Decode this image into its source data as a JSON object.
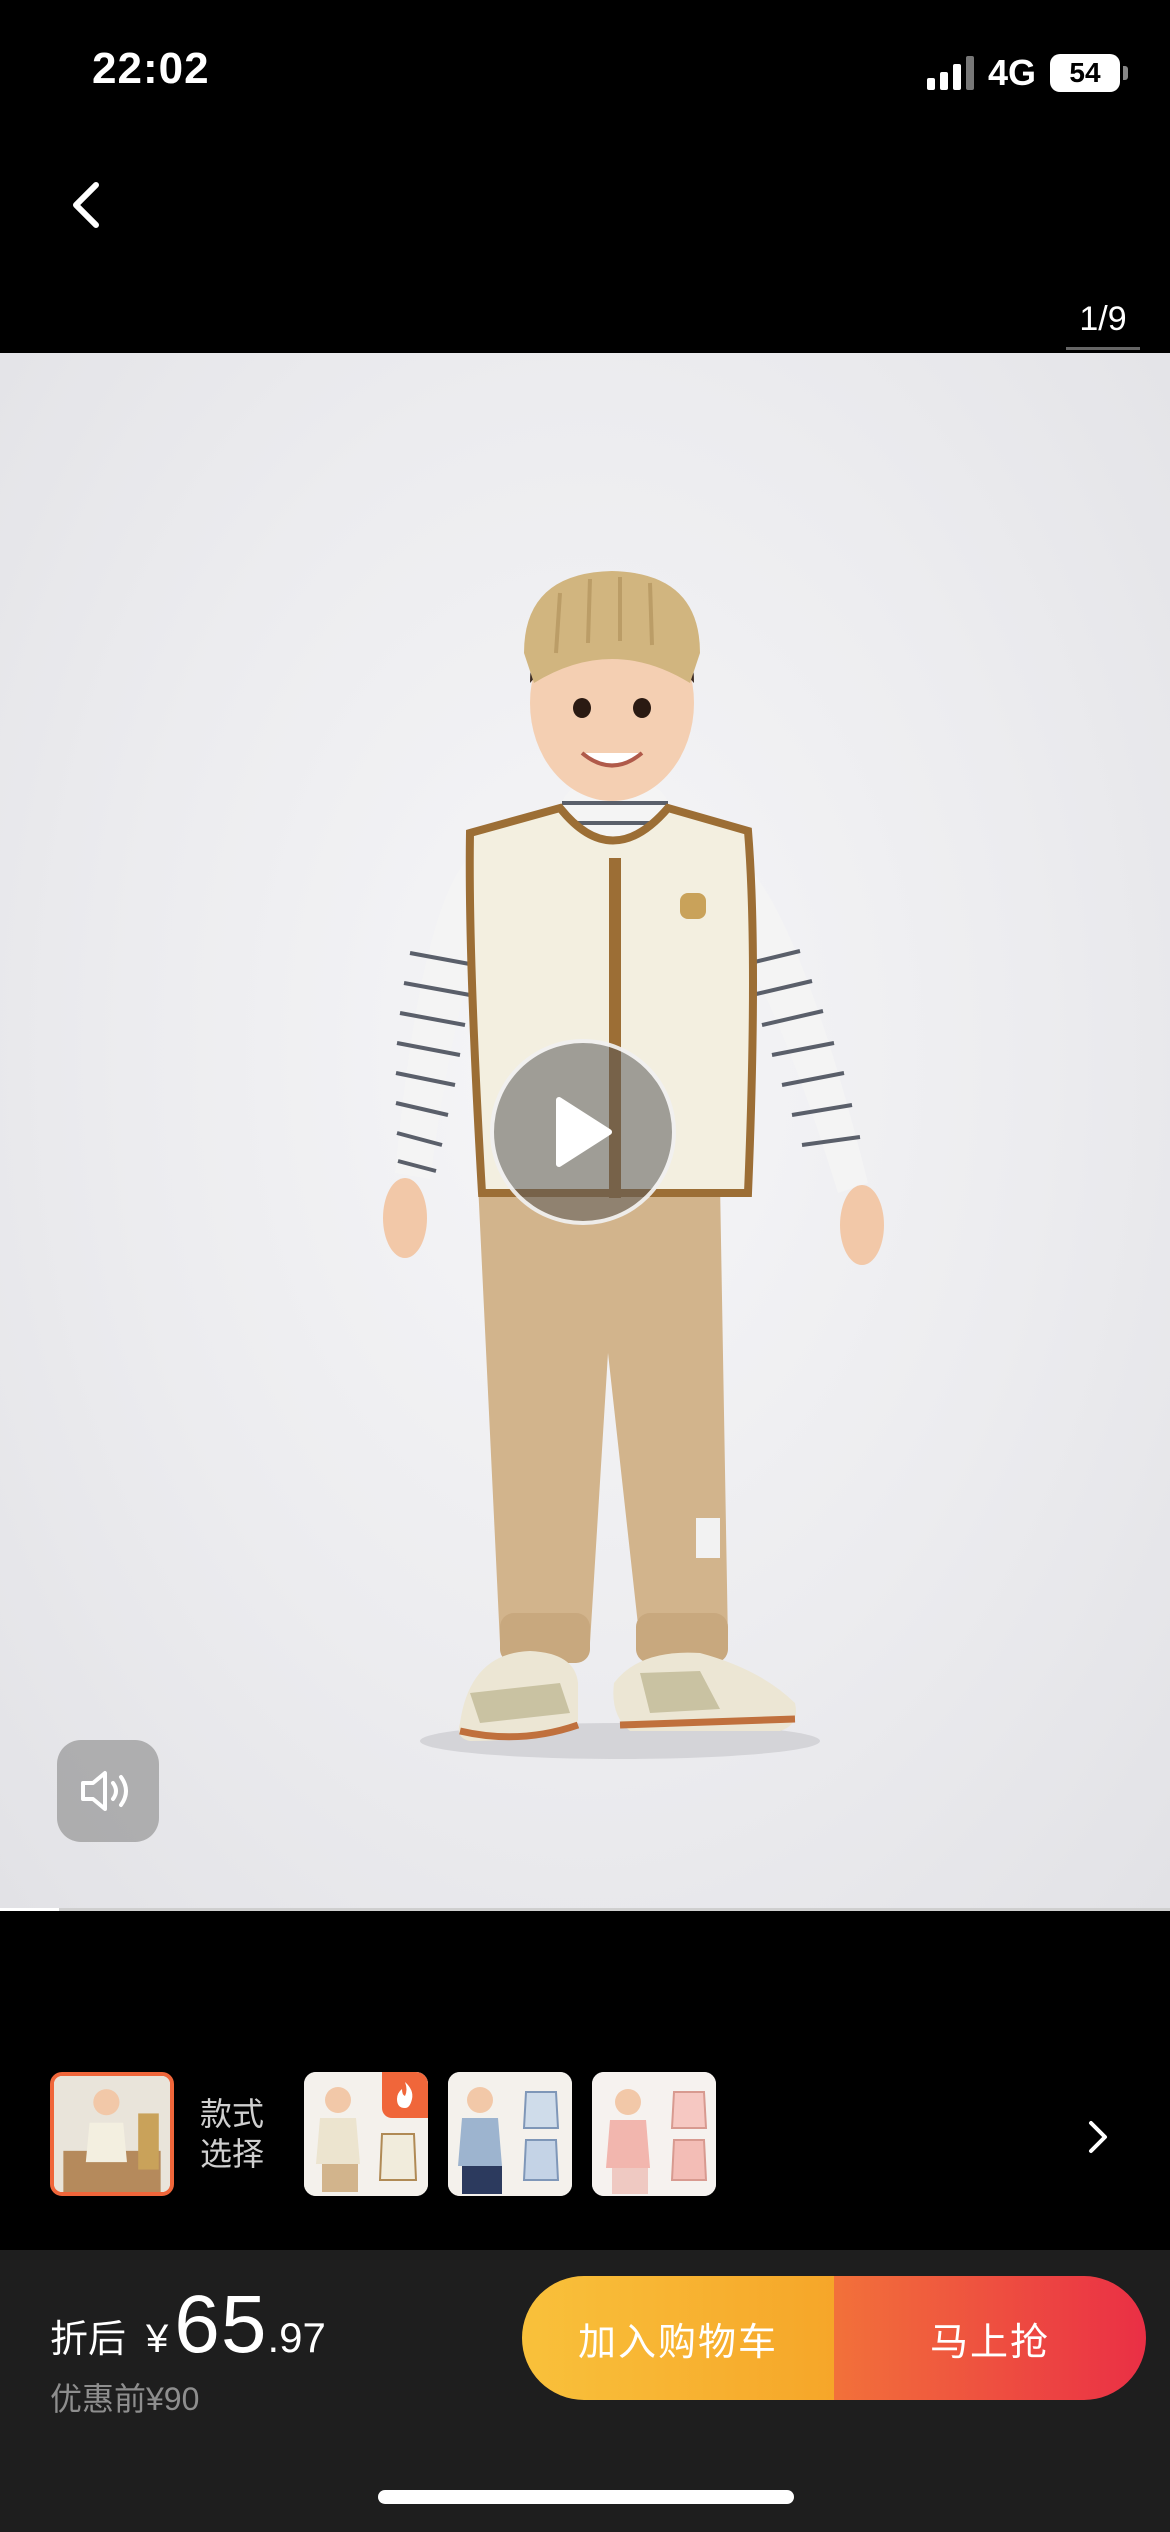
{
  "status_bar": {
    "time": "22:02",
    "network": "4G",
    "battery": "54"
  },
  "gallery": {
    "page_indicator": "1/9",
    "video_progress": 0.05
  },
  "thumbnails": {
    "style_label": "款式\n选择"
  },
  "price": {
    "after_label": "折后",
    "currency": "¥",
    "integer": "65",
    "decimal": ".97",
    "before": "优惠前¥90"
  },
  "actions": {
    "add_to_cart": "加入购物车",
    "buy_now": "马上抢"
  },
  "colors": {
    "accent": "#f0663a",
    "cart_button": "#f7b431",
    "buy_button": "#ec3d43"
  },
  "icons": [
    "back-icon",
    "play-icon",
    "speaker-icon",
    "fire-icon",
    "chevron-right-icon",
    "signal-icon",
    "battery-icon"
  ]
}
